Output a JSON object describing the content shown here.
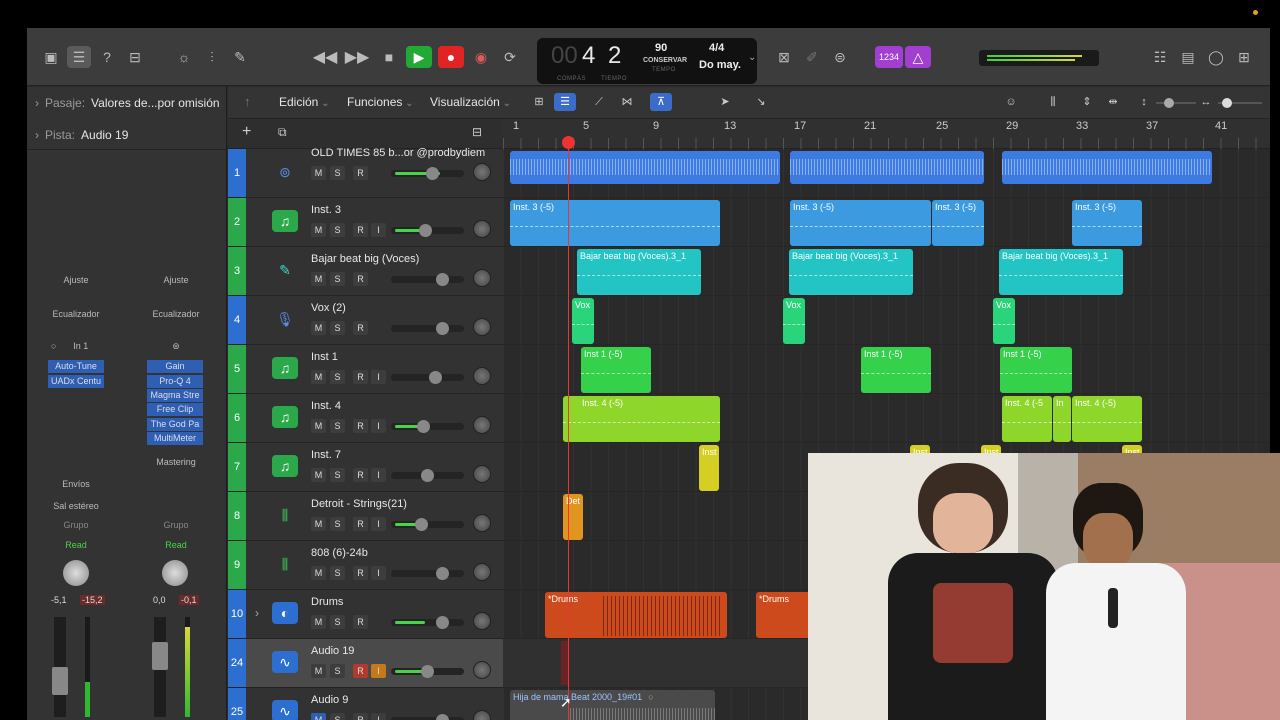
{
  "toolbar": {
    "lcd": {
      "bar": "4",
      "beat": "2",
      "bar_label": "COMPÁS",
      "beat_label": "TIEMPO",
      "tempo": "90",
      "tempo_mode": "CONSERVAR",
      "tempo_label": "TEMPO",
      "signature": "4/4",
      "key": "Do may."
    },
    "badge": "1234",
    "colors": {
      "play": "#22a834",
      "record": "#e02424",
      "badge": "#a23fd1"
    }
  },
  "inspector": {
    "region_label": "Pasaje:",
    "region_value": "Valores de...por omisión",
    "track_label": "Pista:",
    "track_value": "Audio 19",
    "strip1": {
      "setting": "Ajuste",
      "eq": "Ecualizador",
      "input": "In 1",
      "plugins": [
        "Auto-Tune",
        "UADx Centu"
      ],
      "sends": "Envíos",
      "output": "Sal estéreo",
      "group": "Grupo",
      "automation": "Read",
      "val1": "-5,1",
      "val2": "-15,2"
    },
    "strip2": {
      "setting": "Ajuste",
      "eq": "Ecualizador",
      "plugins": [
        "Gain",
        "Pro-Q 4",
        "Magma Stre",
        "Free Clip",
        "The God Pa",
        "MultiMeter"
      ],
      "name": "Mastering",
      "group": "Grupo",
      "automation": "Read",
      "val1": "0,0",
      "val2": "-0,1"
    }
  },
  "editbar": {
    "menus": [
      "Edición",
      "Funciones",
      "Visualización"
    ]
  },
  "ruler": [
    "1",
    "5",
    "9",
    "13",
    "17",
    "21",
    "25",
    "29",
    "33",
    "37",
    "41"
  ],
  "tracks": [
    {
      "num": "1",
      "name": "OLD TIMES 85 b...or @prodbydiem",
      "color": "#2d6fd1"
    },
    {
      "num": "2",
      "name": "Inst. 3",
      "color": "#2aa84a"
    },
    {
      "num": "3",
      "name": "Bajar beat big (Voces)",
      "color": "#2aa84a"
    },
    {
      "num": "4",
      "name": "Vox (2)",
      "color": "#2d6fd1"
    },
    {
      "num": "5",
      "name": "Inst 1",
      "color": "#2aa84a"
    },
    {
      "num": "6",
      "name": "Inst. 4",
      "color": "#2aa84a"
    },
    {
      "num": "7",
      "name": "Inst. 7",
      "color": "#2aa84a"
    },
    {
      "num": "8",
      "name": "Detroit - Strings(21)",
      "color": "#2aa84a"
    },
    {
      "num": "9",
      "name": "808 (6)-24b",
      "color": "#2aa84a"
    },
    {
      "num": "10",
      "name": "Drums",
      "color": "#2d6fd1"
    },
    {
      "num": "24",
      "name": "Audio 19",
      "color": "#2d6fd1"
    },
    {
      "num": "25",
      "name": "Audio 9",
      "color": "#2d6fd1"
    }
  ],
  "track_buttons": {
    "m": "M",
    "s": "S",
    "r": "R",
    "i": "I"
  },
  "regions": {
    "inst3": "Inst. 3 (-5)",
    "bajar": "Bajar beat big (Voces).3_1",
    "vox": "Vox",
    "inst1": "Inst 1 (-5)",
    "inst4": "Inst. 4 (-5)",
    "inst4b": "Inst. 4 (-5",
    "inst4c": "In",
    "inst7": "Inst",
    "det": "Det",
    "drums": "*Drums",
    "audio9": "Hija de mama Beat 2000_19#01"
  }
}
